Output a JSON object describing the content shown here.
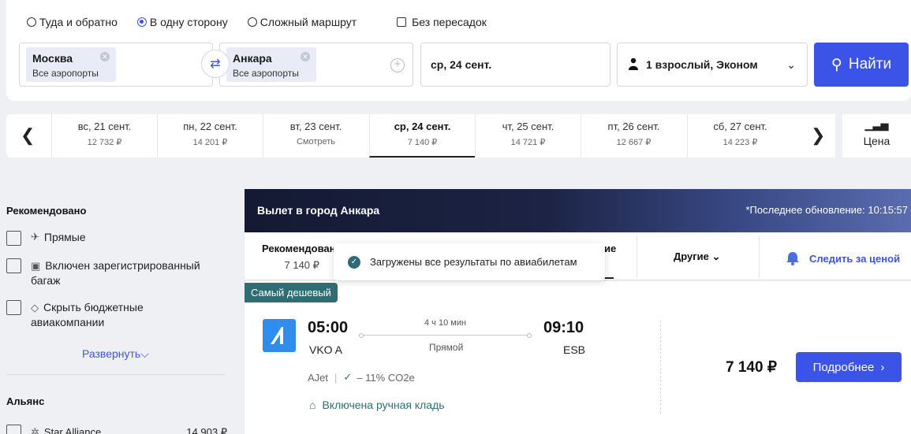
{
  "search": {
    "trip_types": [
      {
        "label": "Туда и обратно",
        "selected": false
      },
      {
        "label": "В одну сторону",
        "selected": true
      },
      {
        "label": "Сложный маршрут",
        "selected": false
      }
    ],
    "nonstop_label": "Без пересадок",
    "from": {
      "city": "Москва",
      "sub": "Все аэропорты"
    },
    "to": {
      "city": "Анкара",
      "sub": "Все аэропорты"
    },
    "date": "ср, 24 сент.",
    "passengers": "1 взрослый, Эконом",
    "find_label": "Найти"
  },
  "date_strip": {
    "days": [
      {
        "date": "вс, 21 сент.",
        "price": "12 732 ₽"
      },
      {
        "date": "пн, 22 сент.",
        "price": "14 201 ₽"
      },
      {
        "date": "вт, 23 сент.",
        "price": "Смотреть"
      },
      {
        "date": "ср, 24 сент.",
        "price": "7 140 ₽",
        "active": true
      },
      {
        "date": "чт, 25 сент.",
        "price": "14 721 ₽"
      },
      {
        "date": "пт, 26 сент.",
        "price": "12 667 ₽"
      },
      {
        "date": "сб, 27 сент.",
        "price": "14 223 ₽"
      }
    ],
    "price_label": "Цена"
  },
  "sidebar": {
    "recommended_title": "Рекомендовано",
    "filters": [
      {
        "icon": "plane-icon",
        "label": "Прямые"
      },
      {
        "icon": "luggage-icon",
        "label": "Включен зарегистрированный багаж"
      },
      {
        "icon": "tag-icon",
        "label": "Скрыть бюджетные авиакомпании"
      }
    ],
    "expand_label": "Развернуть",
    "alliance_title": "Альянс",
    "alliance": {
      "label": "Star Alliance",
      "price": "14 903 ₽"
    }
  },
  "results": {
    "banner_title": "Вылет в город Анкара",
    "last_update": "*Последнее обновление: 10:15:57",
    "sort": {
      "recommended_label": "Рекомендовано",
      "recommended_price": "7 140 ₽",
      "partial_label": "ие",
      "others_label": "Другие",
      "watch_label": "Следить за ценой"
    },
    "toast": "Загружены все результаты по авиабилетам"
  },
  "ticket": {
    "badge": "Самый дешевый",
    "dep_time": "05:00",
    "dep_airport": "VKO A",
    "arr_time": "09:10",
    "arr_airport": "ESB",
    "duration": "4 ч 10 мин",
    "stops": "Прямой",
    "airline": "AJet",
    "co2": "– 11% CO2e",
    "baggage": "Включена ручная кладь",
    "price": "7 140 ₽",
    "details_label": "Подробнее"
  },
  "colors": {
    "accent": "#3b53e6",
    "teal": "#2f6d75",
    "banner_dark": "#141a33"
  }
}
